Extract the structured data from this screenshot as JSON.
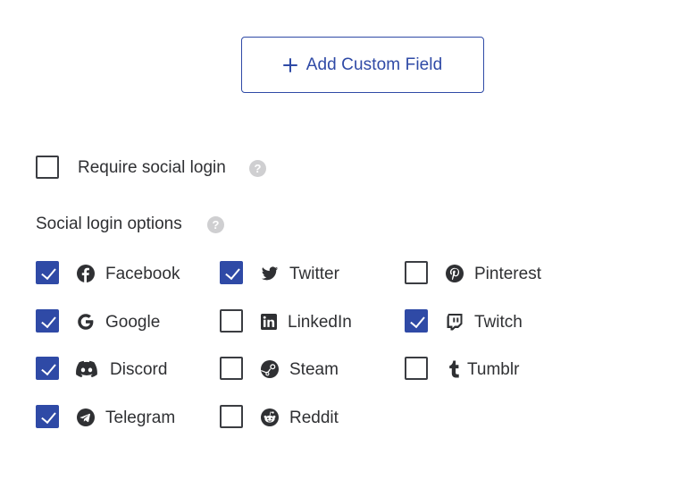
{
  "add_button": {
    "label": "Add Custom Field",
    "icon": "plus-icon"
  },
  "require_social": {
    "label": "Require social login",
    "checked": false,
    "help_icon": "?"
  },
  "social_options": {
    "title": "Social login options",
    "help_icon": "?",
    "items": [
      {
        "label": "Facebook",
        "icon": "facebook-icon",
        "checked": true
      },
      {
        "label": "Twitter",
        "icon": "twitter-icon",
        "checked": true
      },
      {
        "label": "Pinterest",
        "icon": "pinterest-icon",
        "checked": false
      },
      {
        "label": "Google",
        "icon": "google-icon",
        "checked": true
      },
      {
        "label": "LinkedIn",
        "icon": "linkedin-icon",
        "checked": false
      },
      {
        "label": "Twitch",
        "icon": "twitch-icon",
        "checked": true
      },
      {
        "label": "Discord",
        "icon": "discord-icon",
        "checked": true
      },
      {
        "label": "Steam",
        "icon": "steam-icon",
        "checked": false
      },
      {
        "label": "Tumblr",
        "icon": "tumblr-icon",
        "checked": false
      },
      {
        "label": "Telegram",
        "icon": "telegram-icon",
        "checked": true
      },
      {
        "label": "Reddit",
        "icon": "reddit-icon",
        "checked": false
      }
    ]
  },
  "colors": {
    "accent": "#2f4aa6",
    "text": "#2f3033",
    "help": "#cfcfd1"
  }
}
